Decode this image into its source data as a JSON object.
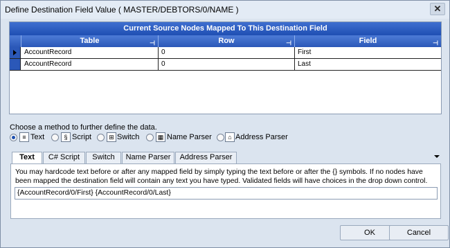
{
  "window": {
    "title": "Define Destination Field Value ( MASTER/DEBTORS/0/NAME )",
    "close_glyph": "✕"
  },
  "grid": {
    "caption": "Current Source Nodes Mapped To This Destination Field",
    "columns": [
      "Table",
      "Row",
      "Field"
    ],
    "pin_glyph": "⊣",
    "rows": [
      {
        "table": "AccountRecord",
        "row": "0",
        "field": "First"
      },
      {
        "table": "AccountRecord",
        "row": "0",
        "field": "Last"
      }
    ]
  },
  "method": {
    "prompt": "Choose a method to further define the data.",
    "options": [
      {
        "label": "Text",
        "icon": "text-icon",
        "selected": true
      },
      {
        "label": "Script",
        "icon": "script-icon",
        "selected": false
      },
      {
        "label": "Switch",
        "icon": "switch-icon",
        "selected": false
      },
      {
        "label": "Name Parser",
        "icon": "name-parser-icon",
        "selected": false
      },
      {
        "label": "Address Parser",
        "icon": "address-parser-icon",
        "selected": false
      }
    ]
  },
  "tabs": {
    "items": [
      "Text",
      "C# Script",
      "Switch",
      "Name Parser",
      "Address Parser"
    ],
    "active": "Text"
  },
  "text_panel": {
    "description": "You may hardcode text before or after any mapped field by simply typing the text before or after the {} symbols.  If no nodes have been mapped the destination field will contain any text you have typed.  Validated fields will have choices in the drop down control.",
    "value": "{AccountRecord/0/First} {AccountRecord/0/Last}"
  },
  "buttons": {
    "ok": "OK",
    "cancel": "Cancel"
  },
  "colors": {
    "grid_header": "#2b58b8",
    "window_bg": "#dbe4ef"
  }
}
